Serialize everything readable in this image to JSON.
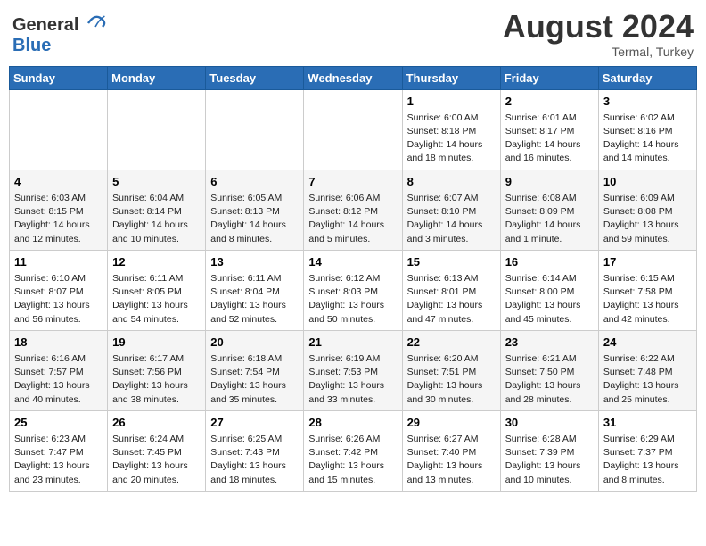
{
  "header": {
    "logo_general": "General",
    "logo_blue": "Blue",
    "month_year": "August 2024",
    "location": "Termal, Turkey"
  },
  "weekdays": [
    "Sunday",
    "Monday",
    "Tuesday",
    "Wednesday",
    "Thursday",
    "Friday",
    "Saturday"
  ],
  "weeks": [
    [
      {
        "day": "",
        "info": ""
      },
      {
        "day": "",
        "info": ""
      },
      {
        "day": "",
        "info": ""
      },
      {
        "day": "",
        "info": ""
      },
      {
        "day": "1",
        "info": "Sunrise: 6:00 AM\nSunset: 8:18 PM\nDaylight: 14 hours\nand 18 minutes."
      },
      {
        "day": "2",
        "info": "Sunrise: 6:01 AM\nSunset: 8:17 PM\nDaylight: 14 hours\nand 16 minutes."
      },
      {
        "day": "3",
        "info": "Sunrise: 6:02 AM\nSunset: 8:16 PM\nDaylight: 14 hours\nand 14 minutes."
      }
    ],
    [
      {
        "day": "4",
        "info": "Sunrise: 6:03 AM\nSunset: 8:15 PM\nDaylight: 14 hours\nand 12 minutes."
      },
      {
        "day": "5",
        "info": "Sunrise: 6:04 AM\nSunset: 8:14 PM\nDaylight: 14 hours\nand 10 minutes."
      },
      {
        "day": "6",
        "info": "Sunrise: 6:05 AM\nSunset: 8:13 PM\nDaylight: 14 hours\nand 8 minutes."
      },
      {
        "day": "7",
        "info": "Sunrise: 6:06 AM\nSunset: 8:12 PM\nDaylight: 14 hours\nand 5 minutes."
      },
      {
        "day": "8",
        "info": "Sunrise: 6:07 AM\nSunset: 8:10 PM\nDaylight: 14 hours\nand 3 minutes."
      },
      {
        "day": "9",
        "info": "Sunrise: 6:08 AM\nSunset: 8:09 PM\nDaylight: 14 hours\nand 1 minute."
      },
      {
        "day": "10",
        "info": "Sunrise: 6:09 AM\nSunset: 8:08 PM\nDaylight: 13 hours\nand 59 minutes."
      }
    ],
    [
      {
        "day": "11",
        "info": "Sunrise: 6:10 AM\nSunset: 8:07 PM\nDaylight: 13 hours\nand 56 minutes."
      },
      {
        "day": "12",
        "info": "Sunrise: 6:11 AM\nSunset: 8:05 PM\nDaylight: 13 hours\nand 54 minutes."
      },
      {
        "day": "13",
        "info": "Sunrise: 6:11 AM\nSunset: 8:04 PM\nDaylight: 13 hours\nand 52 minutes."
      },
      {
        "day": "14",
        "info": "Sunrise: 6:12 AM\nSunset: 8:03 PM\nDaylight: 13 hours\nand 50 minutes."
      },
      {
        "day": "15",
        "info": "Sunrise: 6:13 AM\nSunset: 8:01 PM\nDaylight: 13 hours\nand 47 minutes."
      },
      {
        "day": "16",
        "info": "Sunrise: 6:14 AM\nSunset: 8:00 PM\nDaylight: 13 hours\nand 45 minutes."
      },
      {
        "day": "17",
        "info": "Sunrise: 6:15 AM\nSunset: 7:58 PM\nDaylight: 13 hours\nand 42 minutes."
      }
    ],
    [
      {
        "day": "18",
        "info": "Sunrise: 6:16 AM\nSunset: 7:57 PM\nDaylight: 13 hours\nand 40 minutes."
      },
      {
        "day": "19",
        "info": "Sunrise: 6:17 AM\nSunset: 7:56 PM\nDaylight: 13 hours\nand 38 minutes."
      },
      {
        "day": "20",
        "info": "Sunrise: 6:18 AM\nSunset: 7:54 PM\nDaylight: 13 hours\nand 35 minutes."
      },
      {
        "day": "21",
        "info": "Sunrise: 6:19 AM\nSunset: 7:53 PM\nDaylight: 13 hours\nand 33 minutes."
      },
      {
        "day": "22",
        "info": "Sunrise: 6:20 AM\nSunset: 7:51 PM\nDaylight: 13 hours\nand 30 minutes."
      },
      {
        "day": "23",
        "info": "Sunrise: 6:21 AM\nSunset: 7:50 PM\nDaylight: 13 hours\nand 28 minutes."
      },
      {
        "day": "24",
        "info": "Sunrise: 6:22 AM\nSunset: 7:48 PM\nDaylight: 13 hours\nand 25 minutes."
      }
    ],
    [
      {
        "day": "25",
        "info": "Sunrise: 6:23 AM\nSunset: 7:47 PM\nDaylight: 13 hours\nand 23 minutes."
      },
      {
        "day": "26",
        "info": "Sunrise: 6:24 AM\nSunset: 7:45 PM\nDaylight: 13 hours\nand 20 minutes."
      },
      {
        "day": "27",
        "info": "Sunrise: 6:25 AM\nSunset: 7:43 PM\nDaylight: 13 hours\nand 18 minutes."
      },
      {
        "day": "28",
        "info": "Sunrise: 6:26 AM\nSunset: 7:42 PM\nDaylight: 13 hours\nand 15 minutes."
      },
      {
        "day": "29",
        "info": "Sunrise: 6:27 AM\nSunset: 7:40 PM\nDaylight: 13 hours\nand 13 minutes."
      },
      {
        "day": "30",
        "info": "Sunrise: 6:28 AM\nSunset: 7:39 PM\nDaylight: 13 hours\nand 10 minutes."
      },
      {
        "day": "31",
        "info": "Sunrise: 6:29 AM\nSunset: 7:37 PM\nDaylight: 13 hours\nand 8 minutes."
      }
    ]
  ]
}
